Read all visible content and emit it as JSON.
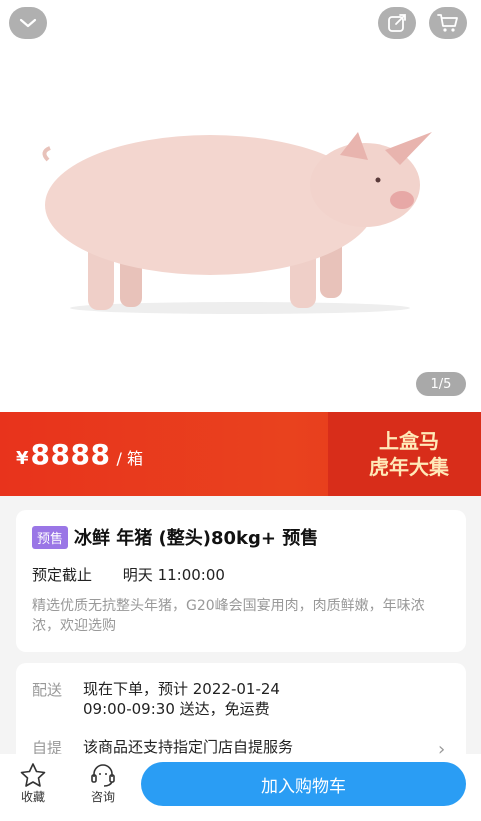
{
  "icons": {
    "collapse": "chevron-down-icon",
    "share": "share-icon",
    "cart": "cart-icon",
    "favorite": "star-icon",
    "consult": "headset-icon"
  },
  "gallery": {
    "counter": "1/5"
  },
  "price": {
    "currency": "¥",
    "amount": "8888",
    "unit": "/ 箱"
  },
  "promo": {
    "line1": "上盒马",
    "line2": "虎年大集"
  },
  "product": {
    "tag": "预售",
    "title": "冰鲜 年猪 (整头)80kg+  预售",
    "deadline_label": "预定截止",
    "deadline_value": "明天 11:00:00",
    "description": "精选优质无抗整头年猪，G20峰会国宴用肉，肉质鲜嫩，年味浓浓，欢迎选购"
  },
  "delivery": {
    "label": "配送",
    "line1": "现在下单，预计 2022-01-24",
    "line2": "09:00-09:30 送达，免运费",
    "pickup_label": "自提",
    "pickup_text": "该商品还支持指定门店自提服务"
  },
  "bottom": {
    "favorite_label": "收藏",
    "consult_label": "咨询",
    "add_cart_label": "加入购物车"
  },
  "colors": {
    "accent": "#2a9df4",
    "price_bg": "#e8331c",
    "tag": "#9a76e6"
  }
}
